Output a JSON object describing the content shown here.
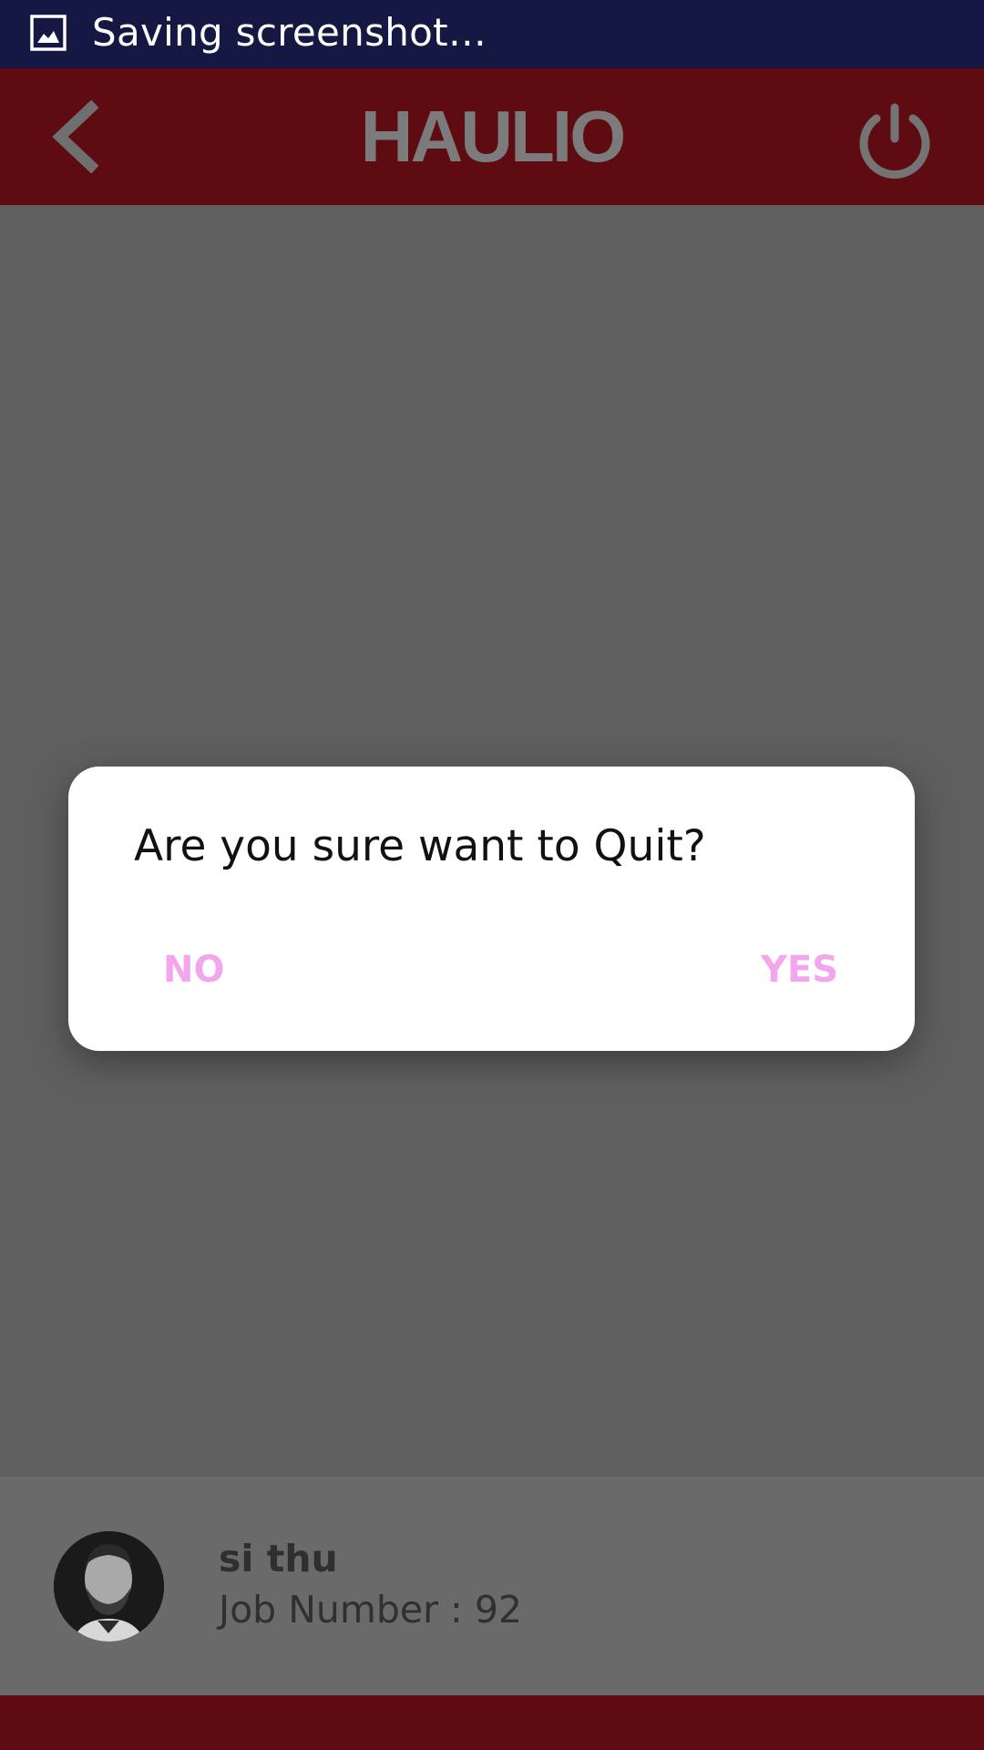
{
  "status_bar": {
    "text": "Saving screenshot…",
    "icon": "image-icon",
    "background": "#141843"
  },
  "header": {
    "brand": "HAULIO",
    "back_icon": "chevron-left-icon",
    "power_icon": "power-icon",
    "background": "#5e0c12"
  },
  "dialog": {
    "message": "Are you sure want to Quit?",
    "no_label": "NO",
    "yes_label": "YES",
    "button_color": "#f3a6ee"
  },
  "profile": {
    "name": "si thu",
    "job_number": "Job Number : 92",
    "avatar_icon": "avatar-photo"
  },
  "colors": {
    "overlay": "#5f5f5f",
    "profile_card": "#6a6a6a"
  }
}
